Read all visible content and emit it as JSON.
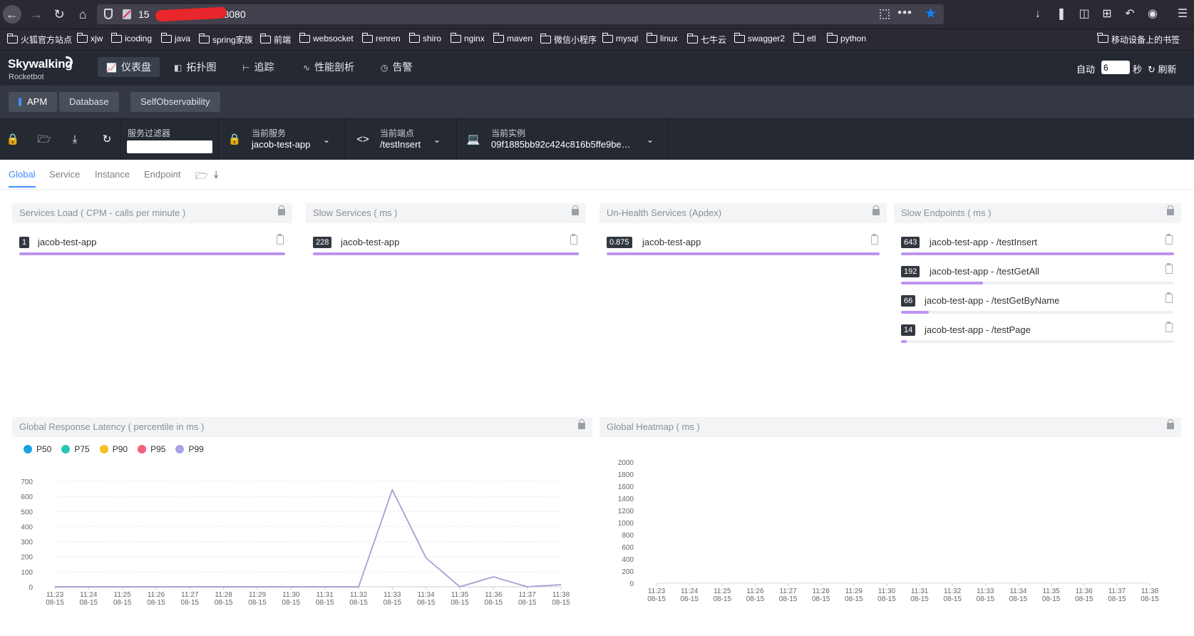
{
  "browser": {
    "url_visible_start": "15",
    "url_visible_end": ":8080",
    "bookmarks": [
      "火狐官方站点",
      "xjw",
      "icoding",
      "java",
      "spring家族",
      "前端",
      "websocket",
      "renren",
      "shiro",
      "nginx",
      "maven",
      "微信小程序",
      "mysql",
      "linux",
      "七牛云",
      "swagger2",
      "etl",
      "python"
    ],
    "mobile_bookmarks": "移动设备上的书签"
  },
  "app": {
    "logo": "Skywalking",
    "logo_sub": "Rocketbot",
    "menu": [
      "仪表盘",
      "拓扑图",
      "追踪",
      "性能剖析",
      "告警"
    ],
    "auto_label": "自动",
    "interval": "6",
    "seconds_label": "秒",
    "refresh_label": "刷新"
  },
  "layers": [
    "APM",
    "Database",
    "SelfObservability"
  ],
  "selectors": {
    "filter_label": "服务过滤器",
    "service_label": "当前服务",
    "service_value": "jacob-test-app",
    "endpoint_label": "当前端点",
    "endpoint_value": "/testInsert",
    "instance_label": "当前实例",
    "instance_value": "09f1885bb92c424c816b5ffe9be…"
  },
  "dashboard_tabs": [
    "Global",
    "Service",
    "Instance",
    "Endpoint"
  ],
  "panels": {
    "services_load": {
      "title": "Services Load ( CPM - calls per minute )",
      "items": [
        {
          "value": "1",
          "name": "jacob-test-app",
          "ratio": 1.0
        }
      ]
    },
    "slow_services": {
      "title": "Slow Services ( ms )",
      "items": [
        {
          "value": "228",
          "name": "jacob-test-app",
          "ratio": 1.0
        }
      ]
    },
    "unhealth_services": {
      "title": "Un-Health Services (Apdex)",
      "items": [
        {
          "value": "0.875",
          "name": "jacob-test-app",
          "ratio": 1.0
        }
      ]
    },
    "slow_endpoints": {
      "title": "Slow Endpoints ( ms )",
      "items": [
        {
          "value": "643",
          "name": "jacob-test-app - /testInsert",
          "ratio": 1.0
        },
        {
          "value": "192",
          "name": "jacob-test-app - /testGetAll",
          "ratio": 0.299
        },
        {
          "value": "66",
          "name": "jacob-test-app - /testGetByName",
          "ratio": 0.103
        },
        {
          "value": "14",
          "name": "jacob-test-app - /testPage",
          "ratio": 0.022
        }
      ]
    },
    "latency_title": "Global Response Latency ( percentile in ms )",
    "heatmap_title": "Global Heatmap ( ms )"
  },
  "chart_data": [
    {
      "type": "line",
      "title": "Global Response Latency ( percentile in ms )",
      "categories": [
        "11:23\n08-15",
        "11:24\n08-15",
        "11:25\n08-15",
        "11:26\n08-15",
        "11:27\n08-15",
        "11:28\n08-15",
        "11:29\n08-15",
        "11:30\n08-15",
        "11:31\n08-15",
        "11:32\n08-15",
        "11:33\n08-15",
        "11:34\n08-15",
        "11:35\n08-15",
        "11:36\n08-15",
        "11:37\n08-15",
        "11:38\n08-15"
      ],
      "ylim": [
        0,
        700
      ],
      "yticks": [
        0,
        100,
        200,
        300,
        400,
        500,
        600,
        700
      ],
      "legend": "top-left",
      "series": [
        {
          "name": "P50",
          "color": "#1ba1e2",
          "values": [
            0,
            0,
            0,
            0,
            0,
            0,
            0,
            0,
            0,
            0,
            643,
            192,
            0,
            66,
            0,
            14
          ]
        },
        {
          "name": "P75",
          "color": "#26c6b0",
          "values": [
            0,
            0,
            0,
            0,
            0,
            0,
            0,
            0,
            0,
            0,
            643,
            192,
            0,
            66,
            0,
            14
          ]
        },
        {
          "name": "P90",
          "color": "#f6c022",
          "values": [
            0,
            0,
            0,
            0,
            0,
            0,
            0,
            0,
            0,
            0,
            643,
            192,
            0,
            66,
            0,
            14
          ]
        },
        {
          "name": "P95",
          "color": "#f2637b",
          "values": [
            0,
            0,
            0,
            0,
            0,
            0,
            0,
            0,
            0,
            0,
            643,
            192,
            0,
            66,
            0,
            14
          ]
        },
        {
          "name": "P99",
          "color": "#a6a3e8",
          "values": [
            0,
            0,
            0,
            0,
            0,
            0,
            0,
            0,
            0,
            0,
            643,
            192,
            0,
            66,
            0,
            14
          ]
        }
      ]
    },
    {
      "type": "heatmap",
      "title": "Global Heatmap ( ms )",
      "categories": [
        "11:23\n08-15",
        "11:24\n08-15",
        "11:25\n08-15",
        "11:26\n08-15",
        "11:27\n08-15",
        "11:28\n08-15",
        "11:29\n08-15",
        "11:30\n08-15",
        "11:31\n08-15",
        "11:32\n08-15",
        "11:33\n08-15",
        "11:34\n08-15",
        "11:35\n08-15",
        "11:36\n08-15",
        "11:37\n08-15",
        "11:38\n08-15"
      ],
      "ylim": [
        0,
        2000
      ],
      "yticks": [
        0,
        200,
        400,
        600,
        800,
        1000,
        1200,
        1400,
        1600,
        1800,
        2000
      ],
      "values": []
    }
  ]
}
